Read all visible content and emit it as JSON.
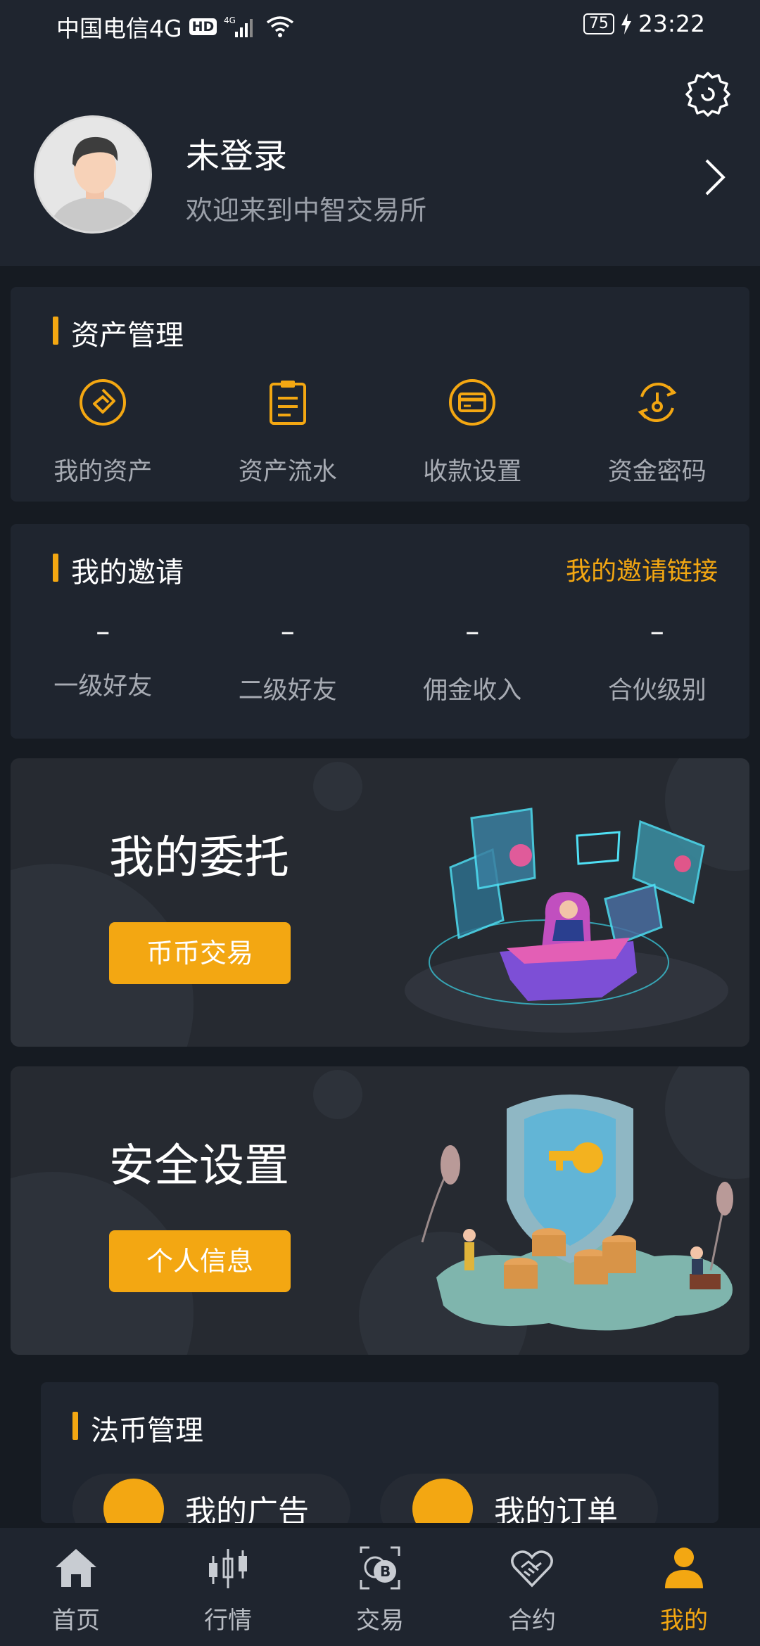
{
  "status_bar": {
    "carrier": "中国电信4G",
    "hd": "HD",
    "signal_label": "4G",
    "battery": "75",
    "time": "23:22"
  },
  "profile": {
    "name": "未登录",
    "welcome": "欢迎来到中智交易所"
  },
  "asset_management": {
    "title": "资产管理",
    "items": [
      {
        "label": "我的资产",
        "icon": "wallet-diamond-icon"
      },
      {
        "label": "资产流水",
        "icon": "clipboard-list-icon"
      },
      {
        "label": "收款设置",
        "icon": "card-icon"
      },
      {
        "label": "资金密码",
        "icon": "key-refresh-icon"
      }
    ]
  },
  "invites": {
    "title": "我的邀请",
    "link_label": "我的邀请链接",
    "items": [
      {
        "value": "–",
        "label": "一级好友"
      },
      {
        "value": "–",
        "label": "二级好友"
      },
      {
        "value": "–",
        "label": "佣金收入"
      },
      {
        "value": "–",
        "label": "合伙级别"
      }
    ]
  },
  "promo_orders": {
    "title": "我的委托",
    "button": "币币交易"
  },
  "promo_security": {
    "title": "安全设置",
    "button": "个人信息"
  },
  "fiat": {
    "title": "法币管理",
    "items": [
      {
        "label": "我的广告",
        "icon": "monitor-icon"
      },
      {
        "label": "我的订单",
        "icon": "document-icon"
      }
    ]
  },
  "tabs": [
    {
      "label": "首页",
      "icon": "home-icon"
    },
    {
      "label": "行情",
      "icon": "candlestick-icon"
    },
    {
      "label": "交易",
      "icon": "bitcoin-exchange-icon"
    },
    {
      "label": "合约",
      "icon": "handshake-icon"
    },
    {
      "label": "我的",
      "icon": "user-icon",
      "active": true
    }
  ],
  "colors": {
    "accent": "#f3a712",
    "background": "#161b22",
    "card": "#1f252f"
  }
}
